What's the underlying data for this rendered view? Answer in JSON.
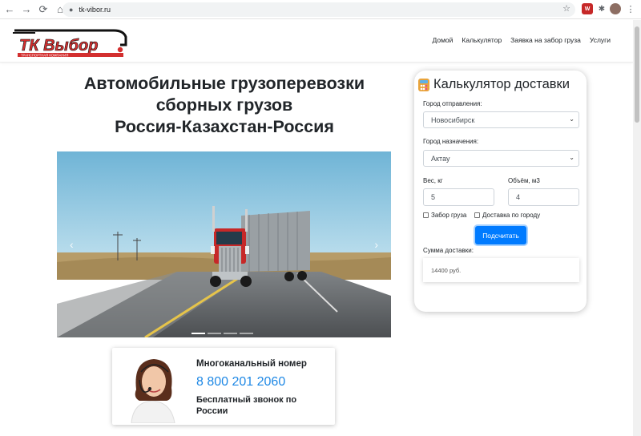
{
  "browser": {
    "url": "tk-vibor.ru",
    "back_glyph": "←",
    "forward_glyph": "→",
    "reload_glyph": "⟳",
    "home_glyph": "⌂",
    "lock_glyph": "🔒",
    "star_glyph": "☆",
    "extension_glyph": "✱",
    "menu_glyph": "⋮",
    "shield_label": "W"
  },
  "header": {
    "logo_text": "ТК Выбор",
    "logo_subtext": "ТРАНСПОРТНАЯ КОМПАНИЯ",
    "nav": [
      "Домой",
      "Калькулятор",
      "Заявка на забор груза",
      "Услуги"
    ]
  },
  "hero": {
    "headline_line1": "Автомобильные грузоперевозки",
    "headline_line2": "сборных грузов",
    "headline_line3": "Россия-Казахстан-Россия",
    "prev_glyph": "‹",
    "next_glyph": "›",
    "slides": 4,
    "active_slide": 1
  },
  "phone": {
    "title": "Многоканальный номер",
    "number": "8 800 201 2060",
    "note": "Бесплатный звонок по России"
  },
  "calculator": {
    "title": "Калькулятор доставки",
    "from_label": "Город отправления:",
    "from_value": "Новосибирск",
    "to_label": "Город назначения:",
    "to_value": "Актау",
    "weight_label": "Вес, кг",
    "weight_value": "5",
    "volume_label": "Объём, м3",
    "volume_value": "4",
    "pickup_label": "Забор груза",
    "delivery_label": "Доставка по городу",
    "submit_label": "Подсчитать",
    "sum_label": "Сумма доставки:",
    "sum_value": "14400 руб.",
    "chevron_glyph": "⌄"
  },
  "colors": {
    "accent": "#007bff",
    "phone_number": "#1e88e5",
    "logo_red": "#d32f2f"
  }
}
